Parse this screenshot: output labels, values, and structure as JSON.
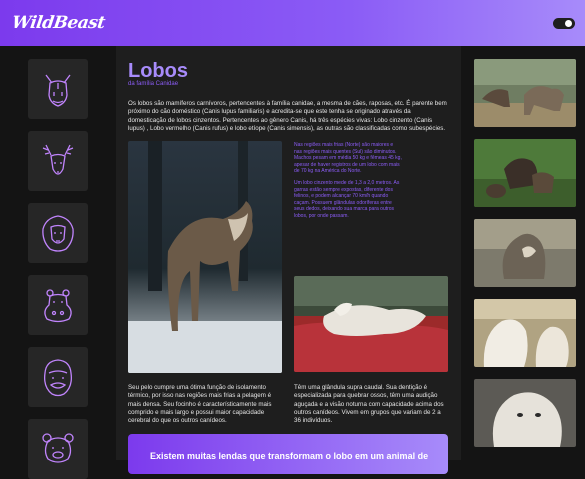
{
  "header": {
    "logo": "WildBeast",
    "theme_toggle": "dark-mode-toggle"
  },
  "sidebar": {
    "animals": [
      {
        "name": "rhino",
        "icon": "rhino-icon"
      },
      {
        "name": "deer",
        "icon": "deer-icon"
      },
      {
        "name": "lion",
        "icon": "lion-icon"
      },
      {
        "name": "hippo",
        "icon": "hippo-icon"
      },
      {
        "name": "gorilla",
        "icon": "gorilla-icon"
      },
      {
        "name": "bear",
        "icon": "bear-icon"
      }
    ]
  },
  "article": {
    "title": "Lobos",
    "subtitle": "da família Canidae",
    "intro": "Os lobos são mamíferos carnívoros, pertencentes à família canidae, a mesma de cães, raposas, etc. É parente bem próximo do cão doméstico (Canis lupus familiaris) e acredita-se que este tenha se originado através da domesticação de lobos cinzentos. Pertencentes ao gênero Canis, há três espécies vivas: Lobo cinzento (Canis lupus) , Lobo vermelho (Canis rufus) e lobo etíope (Canis simensis), as outras são classificadas como subespécies.",
    "note_1": "Nas regiões mais frias (Norte) são maiores e nas regiões mais quentes (Sul) são diminutos. Machos pesam em média 50 kg e fêmeas 45 kg, apesar de haver registros de um lobo com mais de 70 kg na América do Norte.",
    "note_2": "Um lobo cinzento mede de 1,3 a 2,0 metros. As garras estão sempre expostas, diferente dos felinos, e podem alcançar 70 km/h quando caçam. Possuem glândulas odoríferas entre seus dedos, deixando sua marca para outros lobos, por onde passam.",
    "col_left": "Seu pelo cumpre uma ótima função de isolamento térmico, por isso nas regiões mais frias a pelagem é mais densa. Seu focinho é característicamente mais comprido e mais largo e possui maior capacidade cerebral do que os outros canídeos.",
    "col_right": "Têm uma glândula supra caudal. Sua dentição é especializada para quebrar ossos, têm uma audição aguçada e a visão noturna com capacidade acima dos outros canídeos. Vivem em grupos que variam de 2 a 36 indivíduos.",
    "banner": "Existem muitas lendas que transformam o lobo em um animal de"
  },
  "colors": {
    "accent": "#8b5cf6",
    "accent_light": "#a78bfa",
    "panel": "#1e1e1e",
    "background": "#141414"
  }
}
